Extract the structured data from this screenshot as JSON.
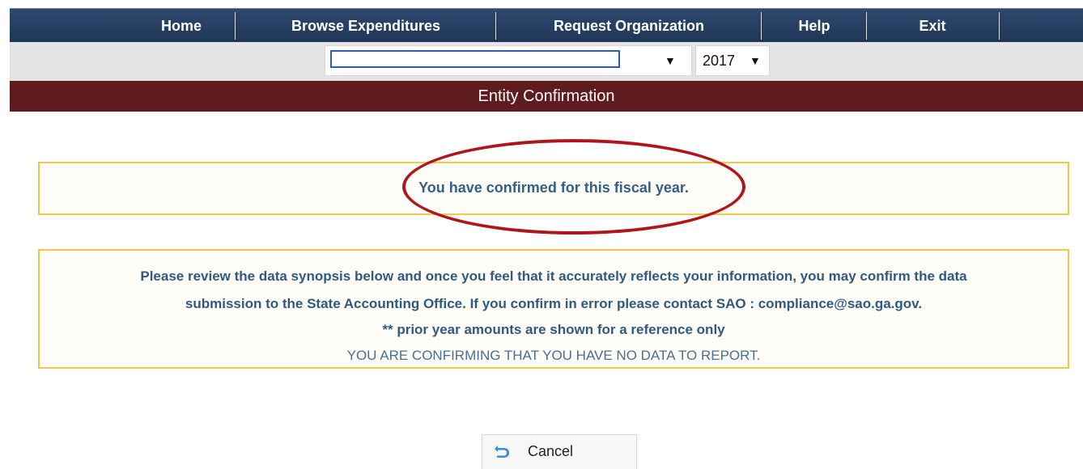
{
  "nav": {
    "items": [
      {
        "label": "Home"
      },
      {
        "label": "Browse Expenditures"
      },
      {
        "label": "Request Organization"
      },
      {
        "label": "Help"
      },
      {
        "label": "Exit"
      }
    ]
  },
  "selectors": {
    "organization_value": "",
    "year_value": "2017",
    "arrow": "▼"
  },
  "page_title": "Entity Confirmation",
  "status_message": "You have confirmed for this fiscal year.",
  "info": {
    "line1": "Please review the data synopsis below and once you feel that it accurately reflects your information, you may confirm the data",
    "line2": "submission to the State Accounting Office. If you confirm in error please contact SAO : compliance@sao.ga.gov.",
    "line3": "** prior year amounts are shown for a reference only",
    "line4": "YOU ARE CONFIRMING THAT YOU HAVE NO DATA TO REPORT."
  },
  "cancel_button": {
    "label": "Cancel",
    "icon": "return-arrow-icon"
  },
  "colors": {
    "nav_bg": "#1e3556",
    "title_bg": "#5e1c1e",
    "box_border": "#f2c84b",
    "text_blue": "#356086",
    "highlight_oval": "#b0151c"
  }
}
